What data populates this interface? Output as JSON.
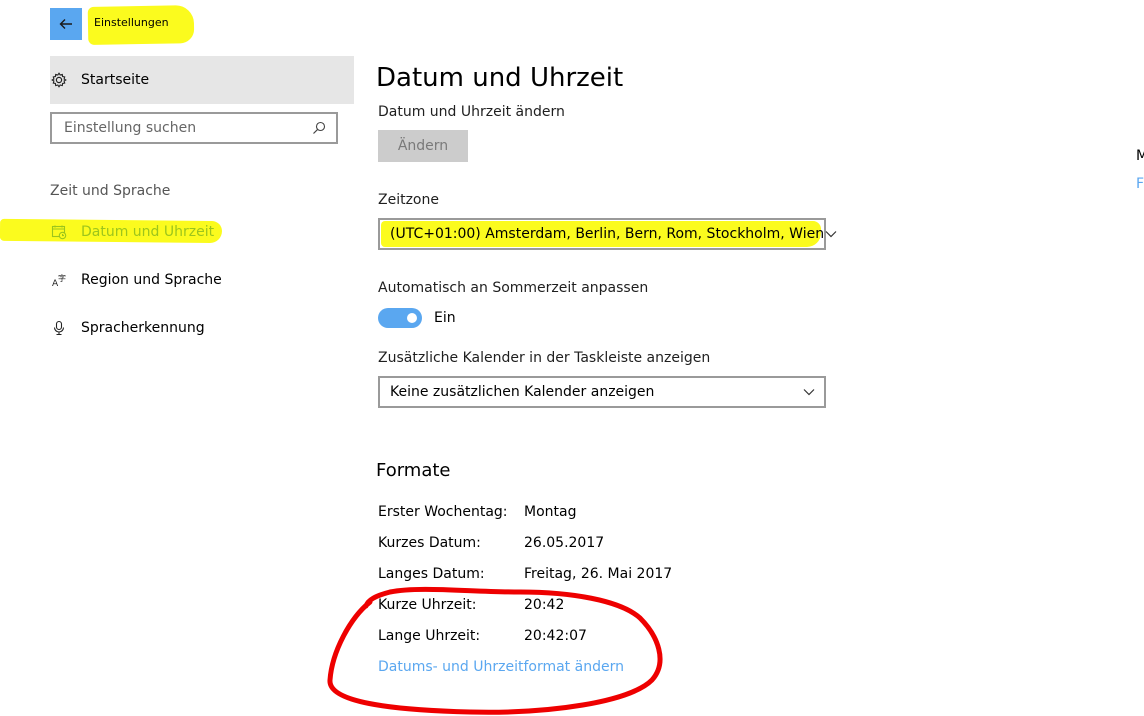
{
  "app": {
    "title": "Einstellungen",
    "back_icon": "arrow-left-icon"
  },
  "sidebar": {
    "home_label": "Startseite",
    "home_icon": "gear-icon",
    "search_placeholder": "Einstellung suchen",
    "search_icon": "search-icon",
    "group_label": "Zeit und Sprache",
    "items": [
      {
        "label": "Datum und Uhrzeit",
        "icon": "calendar-clock-icon",
        "active": true
      },
      {
        "label": "Region und Sprache",
        "icon": "language-icon",
        "active": false
      },
      {
        "label": "Spracherkennung",
        "icon": "microphone-icon",
        "active": false
      }
    ]
  },
  "main": {
    "title": "Datum und Uhrzeit",
    "change_datetime_label": "Datum und Uhrzeit ändern",
    "change_button": "Ändern",
    "timezone_label": "Zeitzone",
    "timezone_value": "(UTC+01:00) Amsterdam, Berlin, Bern, Rom, Stockholm, Wien",
    "dst_label": "Automatisch an Sommerzeit anpassen",
    "dst_state": "Ein",
    "calendar_label": "Zusätzliche Kalender in der Taskleiste anzeigen",
    "calendar_value": "Keine zusätzlichen Kalender anzeigen",
    "formats_title": "Formate",
    "formats": [
      {
        "key": "Erster Wochentag:",
        "value": "Montag"
      },
      {
        "key": "Kurzes Datum:",
        "value": "26.05.2017"
      },
      {
        "key": "Langes Datum:",
        "value": "Freitag, 26. Mai 2017"
      },
      {
        "key": "Kurze Uhrzeit:",
        "value": "20:42"
      },
      {
        "key": "Lange Uhrzeit:",
        "value": "20:42:07"
      }
    ],
    "format_link": "Datums- und Uhrzeitformat ändern"
  },
  "right_panel": {
    "clipped_heading": "M",
    "clipped_link": "F"
  },
  "colors": {
    "accent": "#5aa7f0",
    "highlight": "#fbfb1e",
    "annotation": "#ee0000",
    "active_nav": "#9cc51c"
  }
}
